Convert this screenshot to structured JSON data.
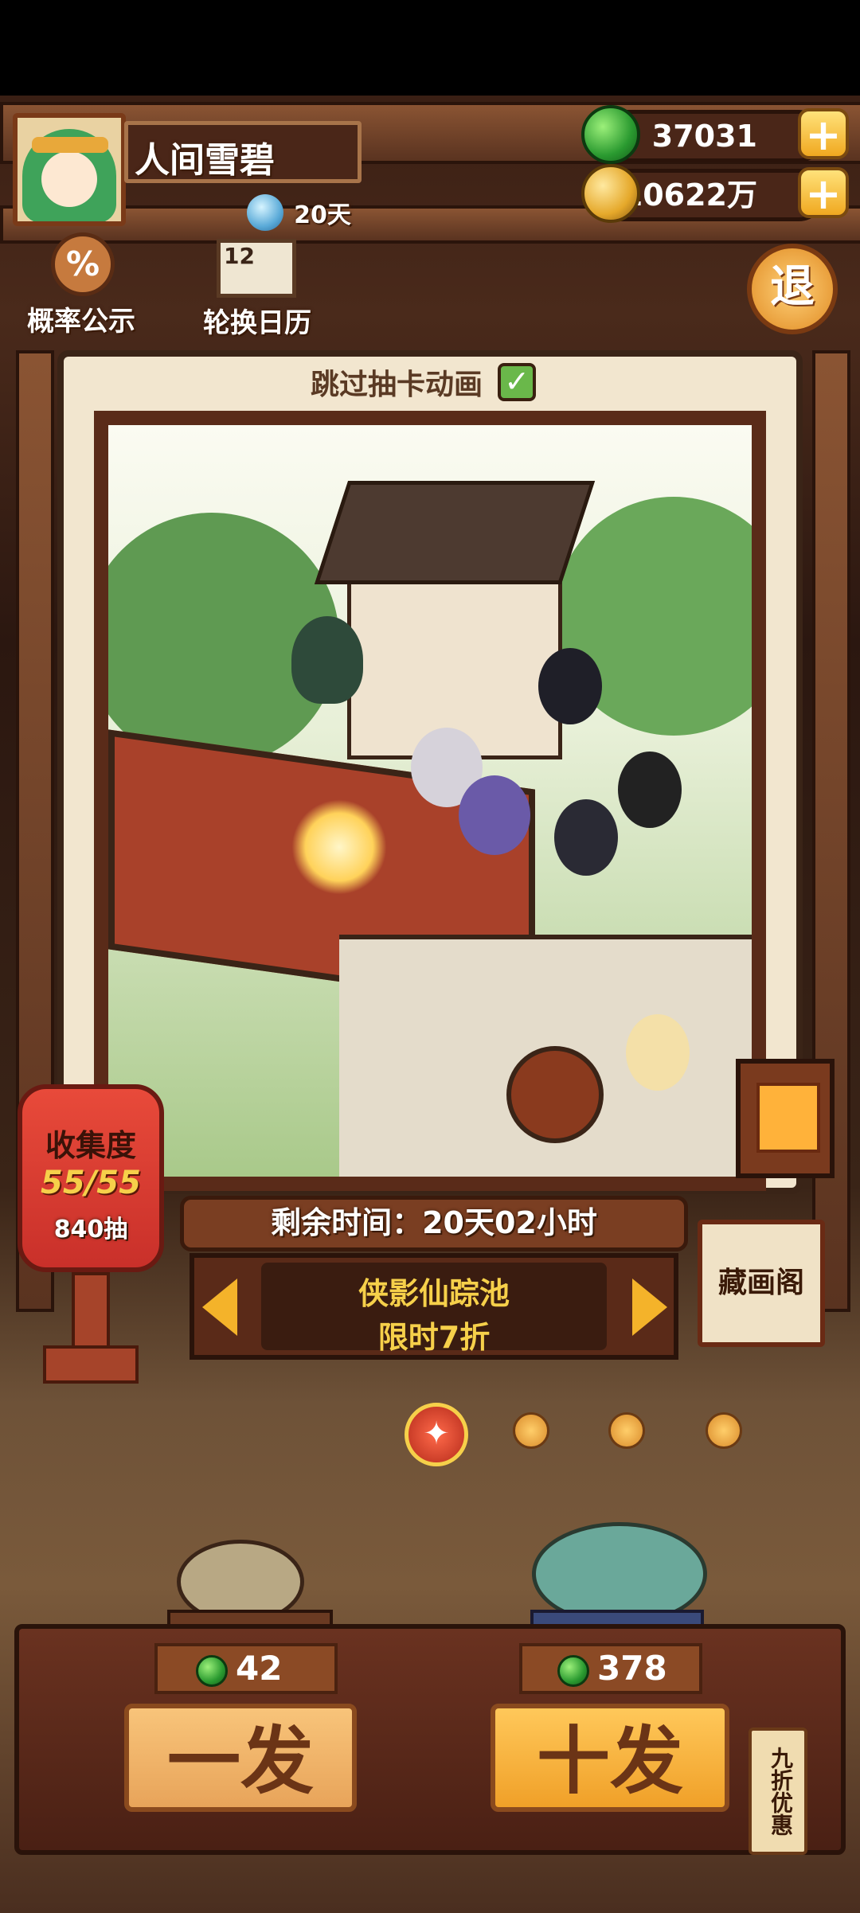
{
  "player": {
    "name": "人间雪碧",
    "item_days": "20天"
  },
  "currency": {
    "jade": "37031",
    "coins": "10622万"
  },
  "top_buttons": {
    "probability": "概率公示",
    "rotation_calendar": "轮换日历",
    "exit": "退",
    "calendar_number": "12"
  },
  "skip_animation": {
    "label": "跳过抽卡动画",
    "checked": true
  },
  "collection": {
    "title": "收集度",
    "progress": "55/55",
    "pulls": "840抽"
  },
  "pool": {
    "remaining_label": "剩余时间：20天02小时",
    "name": "侠影仙踪池",
    "discount": "限时7折"
  },
  "gallery": {
    "label": "藏画阁"
  },
  "draw": {
    "single_price": "42",
    "single_label": "一发",
    "ten_price": "378",
    "ten_label": "十发",
    "ten_tag": "九折优惠"
  },
  "page_indicator": {
    "count": 4,
    "active": 0
  },
  "colors": {
    "accent": "#f0a820",
    "wood": "#5a2b19",
    "jade": "#2a9a30"
  }
}
